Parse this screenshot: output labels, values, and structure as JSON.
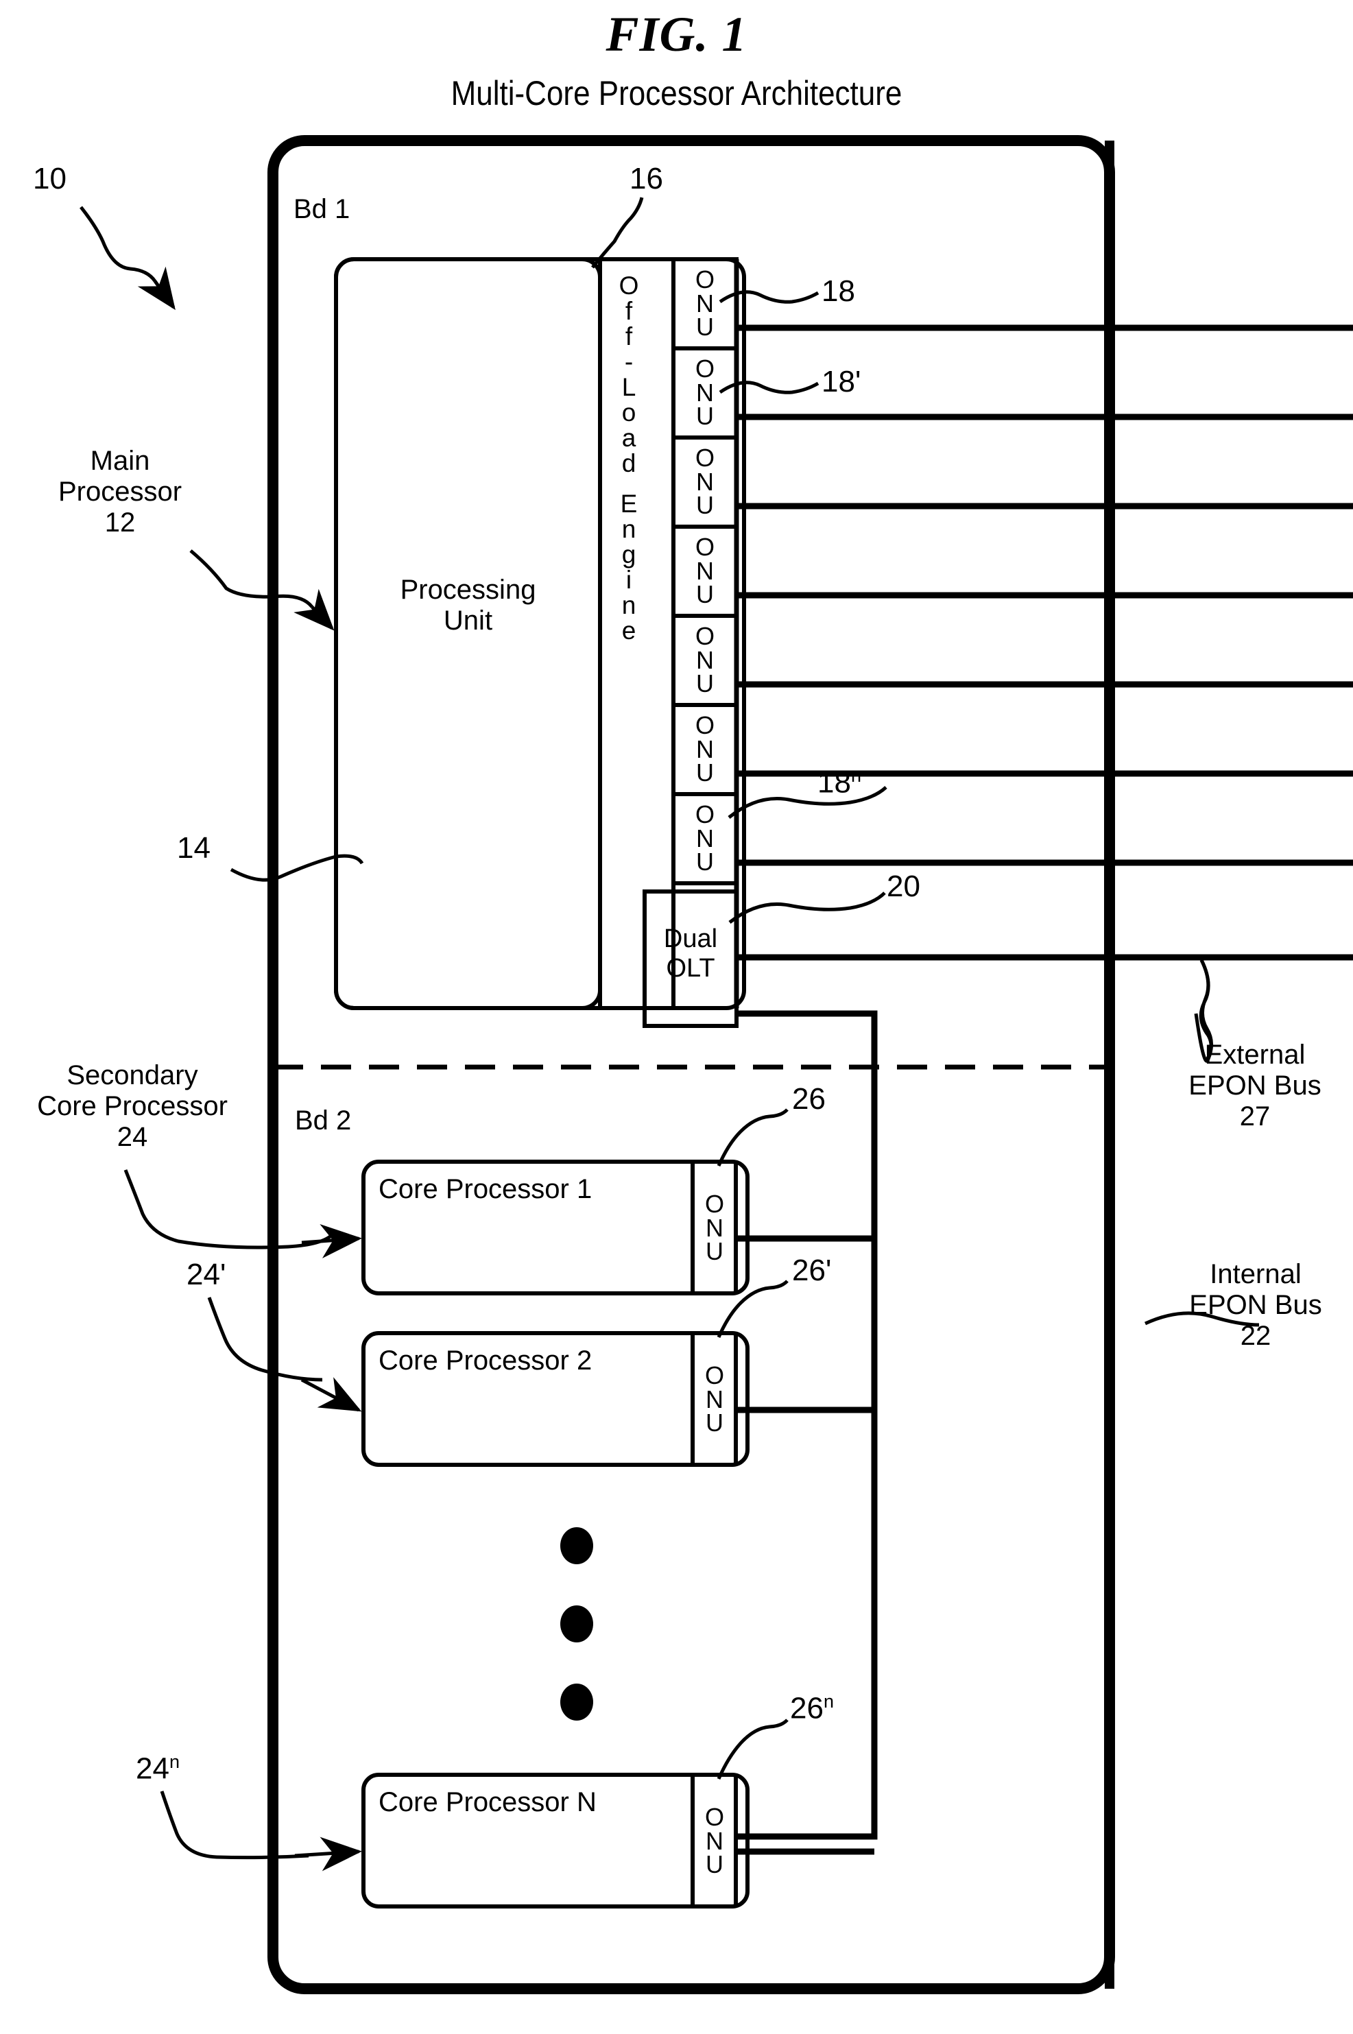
{
  "figure": {
    "number": "FIG. 1",
    "subtitle": "Multi-Core Processor Architecture"
  },
  "references": {
    "system": "10",
    "main_processor_label": "Main\nProcessor",
    "main_processor_num": "12",
    "processing_unit_num": "14",
    "offload_engine_num": "16",
    "onu_first": "18",
    "onu_second": "18'",
    "onu_nth_base": "18",
    "onu_nth_sup": "n",
    "dual_olt_num": "20",
    "internal_bus_label": "Internal\nEPON Bus\n22",
    "external_bus_label": "External\nEPON Bus\n27",
    "secondary_core_label": "Secondary\nCore Processor\n24",
    "core2_num": "24'",
    "coreN_base": "24",
    "coreN_sup": "n",
    "core_onu_first": "26",
    "core_onu_second": "26'",
    "core_onu_nth_base": "26",
    "core_onu_nth_sup": "n"
  },
  "boards": {
    "board1_label": "Bd 1",
    "board2_label": "Bd 2"
  },
  "blocks": {
    "processing_unit": "Processing\nUnit",
    "offload_engine_letters": [
      "O",
      "f",
      "f",
      "-",
      "L",
      "o",
      "a",
      "d",
      " ",
      "E",
      "n",
      "g",
      "i",
      "n",
      "e"
    ],
    "onu_letters": [
      "O",
      "N",
      "U"
    ],
    "dual_olt": "Dual\nOLT",
    "core_processors": [
      {
        "name": "Core Processor 1"
      },
      {
        "name": "Core Processor 2"
      },
      {
        "name": "Core Processor N"
      }
    ]
  },
  "counts": {
    "offload_onu_boxes": 7,
    "external_bus_lines": 8,
    "ellipsis_dots": 3
  },
  "colors": {
    "ink": "#000000",
    "paper": "#ffffff"
  }
}
